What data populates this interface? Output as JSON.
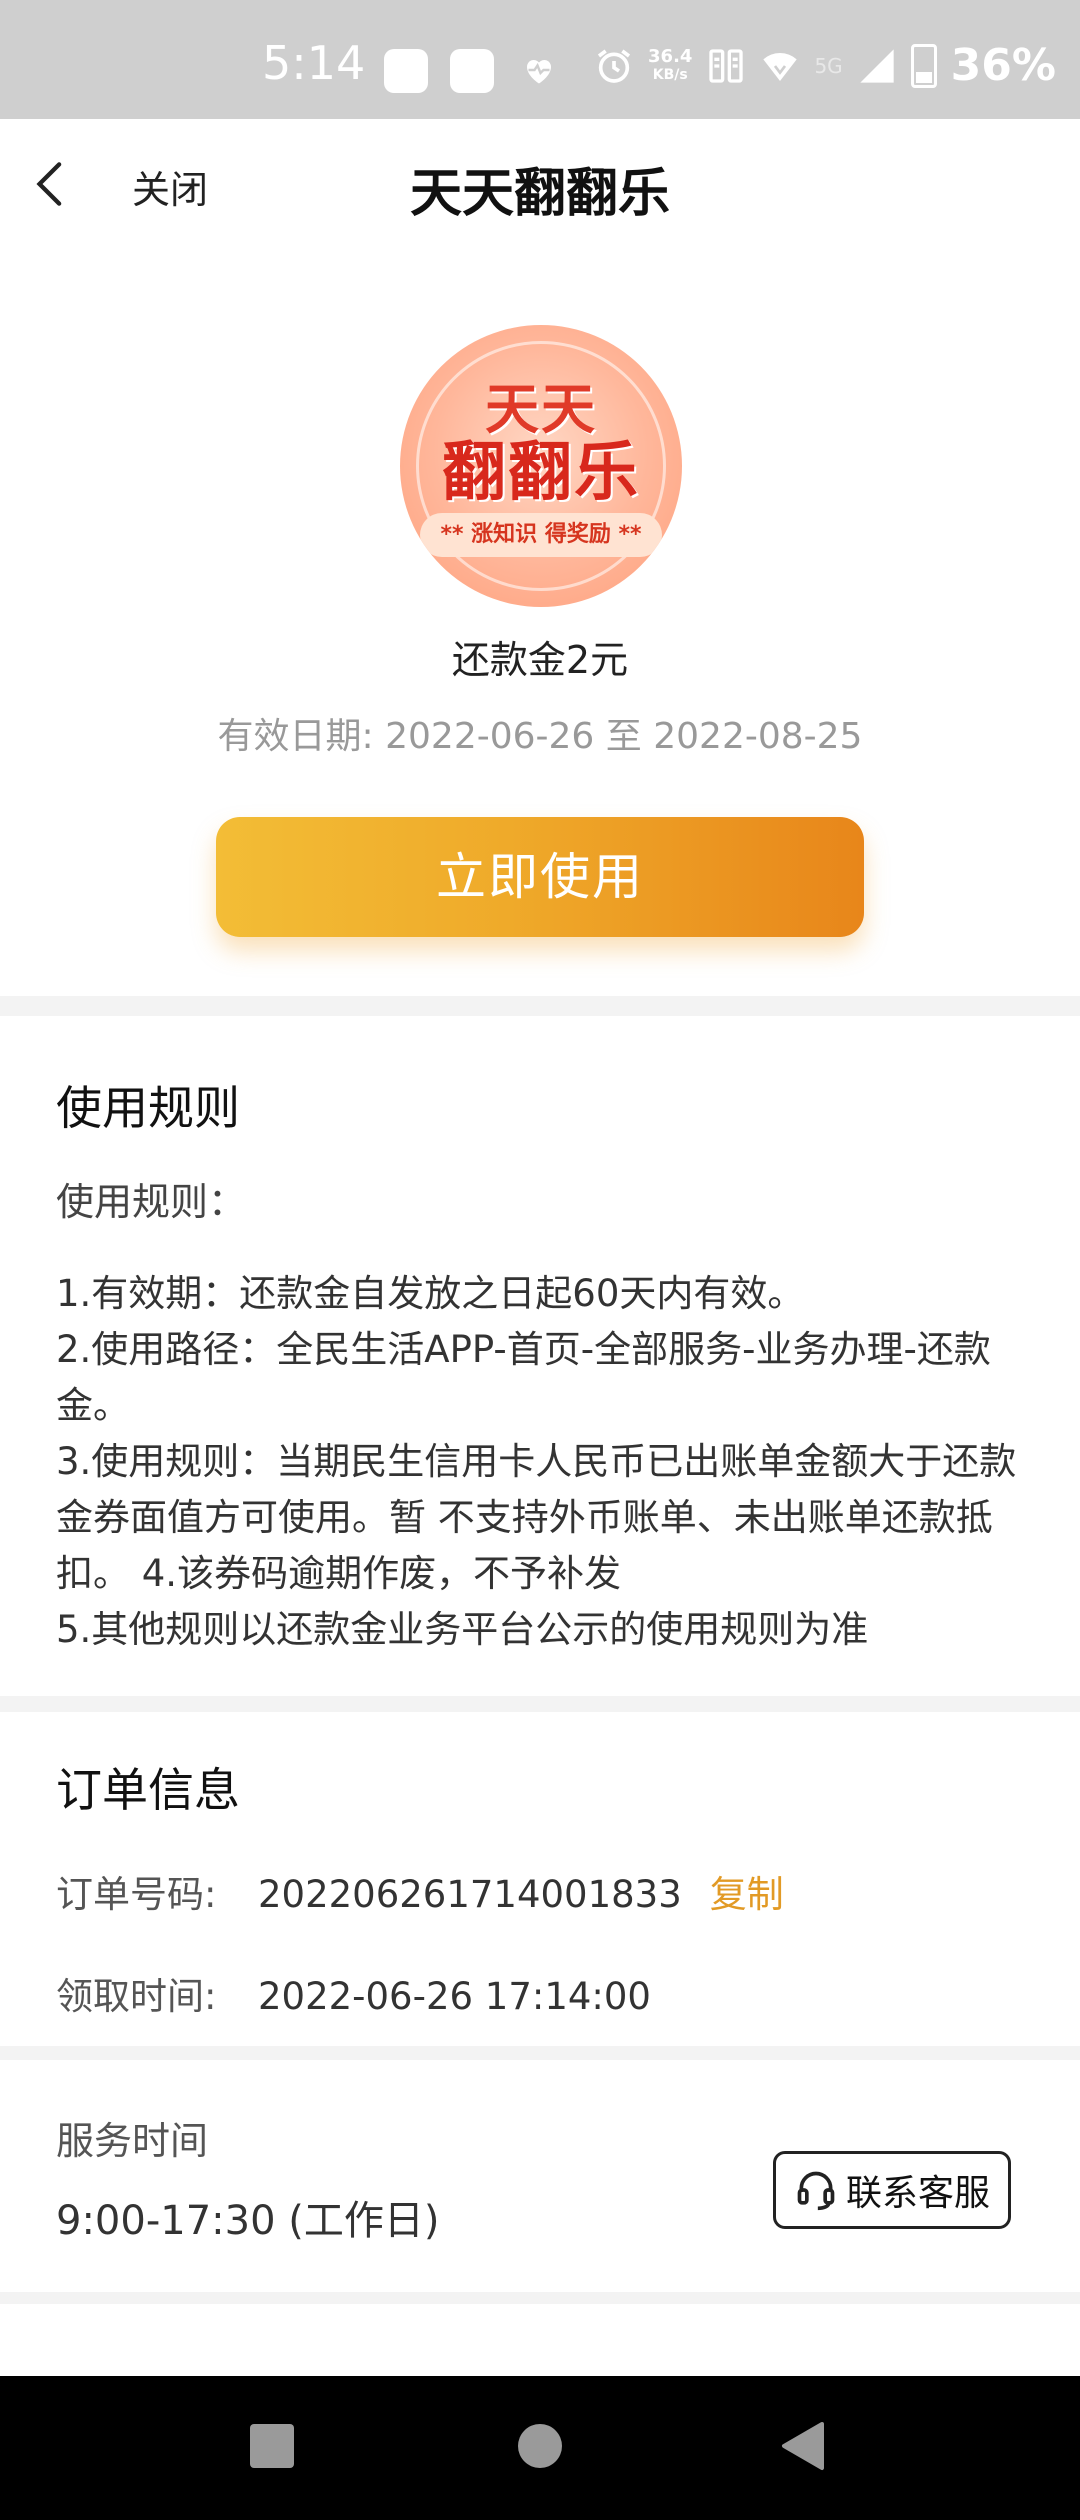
{
  "status_bar": {
    "time": "5:14",
    "net_speed_value": "36.4",
    "net_speed_unit": "KB/s",
    "network_label": "5G",
    "battery": "36%"
  },
  "nav": {
    "close_label": "关闭",
    "title": "天天翻翻乐"
  },
  "hero": {
    "logo_line1": "天天",
    "logo_line2": "翻翻乐",
    "logo_banner": "** 涨知识 得奖励 **",
    "reward_name": "还款金2元",
    "valid_label": "有效日期:",
    "valid_start": "2022-06-26",
    "valid_sep": "至",
    "valid_end": "2022-08-25",
    "use_button": "立即使用"
  },
  "rules": {
    "title": "使用规则",
    "subtitle": "使用规则：",
    "lines": [
      "1.有效期：还款金自发放之日起60天内有效。",
      "2.使用路径：全民生活APP-首页-全部服务-业务办理-还款金。",
      "3.使用规则：当期民生信用卡人民币已出账单金额大于还款金券面值方可使用。暂 不支持外币账单、未出账单还款抵扣。 4.该券码逾期作废，不予补发",
      "5.其他规则以还款金业务平台公示的使用规则为准"
    ]
  },
  "order": {
    "title": "订单信息",
    "order_no_label": "订单号码:",
    "order_no": "202206261714001833",
    "copy_label": "复制",
    "time_label": "领取时间:",
    "time_value": "2022-06-26 17:14:00"
  },
  "service": {
    "label": "服务时间",
    "hours": "9:00-17:30 (工作日)",
    "contact_button": "联系客服"
  },
  "colors": {
    "accent": "#e29a25",
    "button_start": "#f3bd36",
    "button_end": "#e8861a"
  }
}
